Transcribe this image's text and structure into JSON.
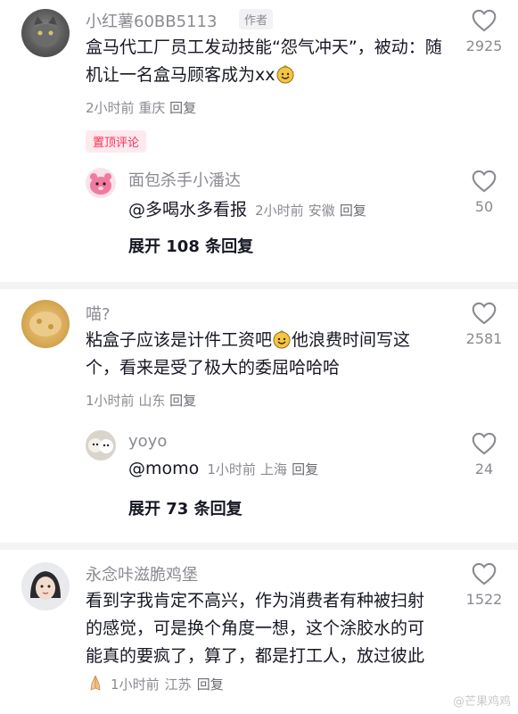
{
  "comments": [
    {
      "username": "小红薯60BB5113",
      "author_badge": "作者",
      "text_a": "盒马代工厂员工发动技能“怨气冲天”，被动：随机让一名盒马顾客成为xx",
      "text_b": "",
      "time": "2小时前",
      "location": "重庆",
      "reply_label": "回复",
      "likes": "2925",
      "pinned_label": "置顶评论",
      "reply": {
        "username": "面包杀手小潘达",
        "text": "@多喝水多看报",
        "time": "2小时前",
        "location": "安徽",
        "reply_label": "回复",
        "likes": "50"
      },
      "expand_label": "展开 108 条回复"
    },
    {
      "username": "喵?",
      "text_a": "粘盒子应该是计件工资吧",
      "text_b": "他浪费时间写这个，看来是受了极大的委屈哈哈哈",
      "time": "1小时前",
      "location": "山东",
      "reply_label": "回复",
      "likes": "2581",
      "reply": {
        "username": "yoyo",
        "text": "@momo",
        "time": "1小时前",
        "location": "上海",
        "reply_label": "回复",
        "likes": "24"
      },
      "expand_label": "展开 73 条回复"
    },
    {
      "username": "永念咔滋脆鸡堡",
      "text_a": "看到字我肯定不高兴，作为消费者有种被扫射的感觉，可是换个角度一想，这个涂胶水的可能真的要疯了，算了，都是打工人，放过彼此",
      "time": "1小时前",
      "location": "江苏",
      "reply_label": "回复",
      "likes": "1522"
    }
  ],
  "watermark": "@芒果鸡鸡",
  "icons": [
    "heart-icon",
    "smile-emoji",
    "pray-emoji"
  ]
}
